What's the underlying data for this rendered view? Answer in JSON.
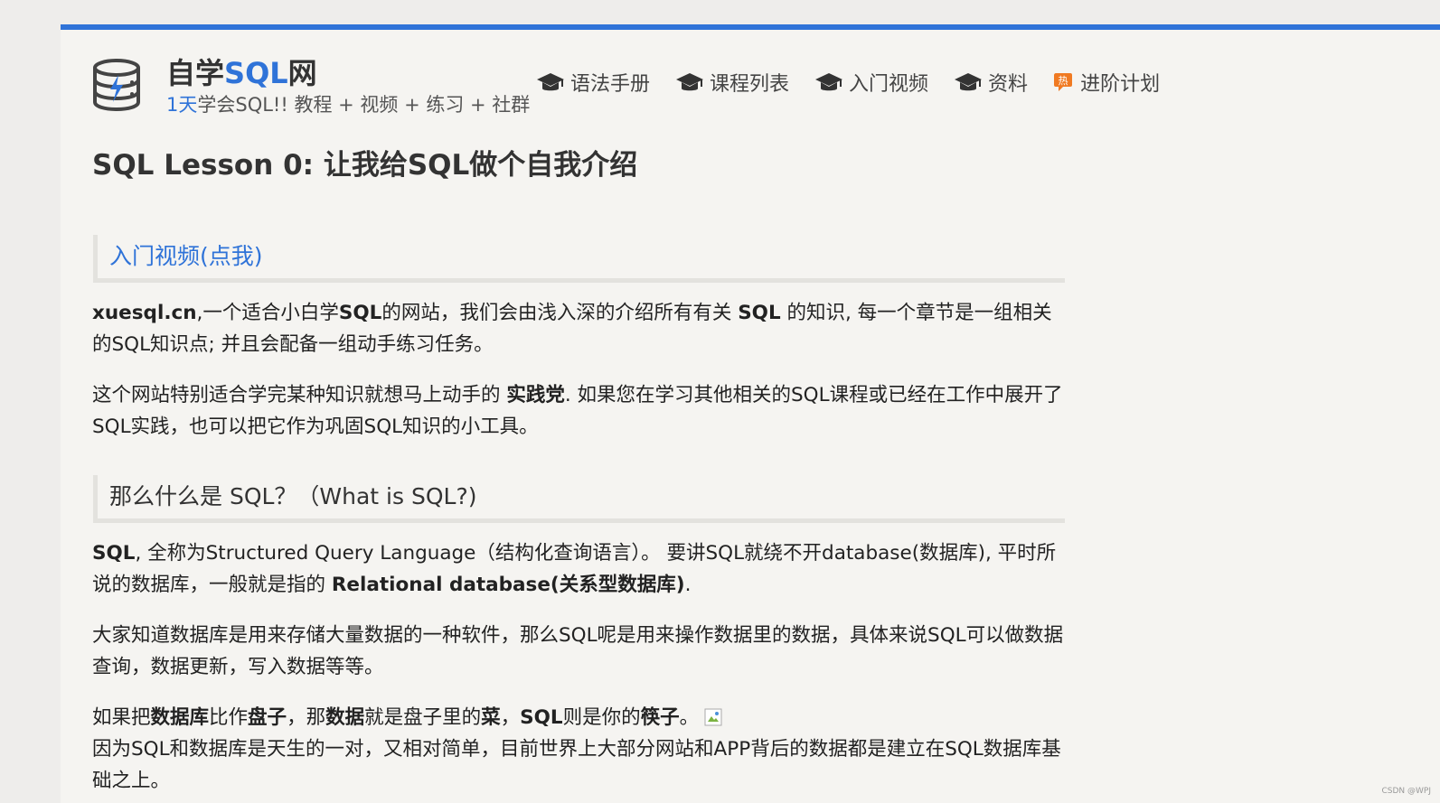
{
  "site": {
    "title_prefix": "自学",
    "title_sql": "SQL",
    "title_suffix": "网",
    "subtitle_num": "1天",
    "subtitle_rest": "学会SQL!! 教程 + 视频 + 练习 + 社群"
  },
  "nav": {
    "items": [
      {
        "label": "语法手册",
        "icon": "graduation-cap-icon"
      },
      {
        "label": "课程列表",
        "icon": "graduation-cap-icon"
      },
      {
        "label": "入门视频",
        "icon": "graduation-cap-icon"
      },
      {
        "label": "资料",
        "icon": "graduation-cap-icon"
      },
      {
        "label": "进阶计划",
        "icon": "hot-badge-icon",
        "badge": "热"
      }
    ]
  },
  "article": {
    "title": "SQL Lesson 0: 让我给SQL做个自我介绍",
    "video_link": "入门视频(点我)",
    "p1": {
      "b1": "xuesql.cn",
      "t1": ",一个适合小白学",
      "b2": "SQL",
      "t2": "的网站，我们会由浅入深的介绍所有有关 ",
      "b3": "SQL",
      "t3": " 的知识, 每一个章节是一组相关的SQL知识点; 并且会配备一组动手练习任务。"
    },
    "p2": {
      "t1": "这个网站特别适合学完某种知识就想马上动手的 ",
      "b1": "实践党",
      "t2": ". 如果您在学习其他相关的SQL课程或已经在工作中展开了SQL实践，也可以把它作为巩固SQL知识的小工具。"
    },
    "what_heading": "那么什么是 SQL？（What is SQL?)",
    "p3": {
      "b1": "SQL",
      "t1": ", 全称为Structured Query Language（结构化查询语言）。 要讲SQL就绕不开database(数据库), 平时所说的数据库，一般就是指的 ",
      "b2": "Relational database(关系型数据库)",
      "t2": "."
    },
    "p4": "大家知道数据库是用来存储大量数据的一种软件，那么SQL呢是用来操作数据里的数据，具体来说SQL可以做数据查询，数据更新，写入数据等等。",
    "p5": {
      "t1": "如果把",
      "b1": "数据库",
      "t2": "比作",
      "b2": "盘子",
      "t3": "，那",
      "b3": "数据",
      "t4": "就是盘子里的",
      "b4": "菜",
      "t5": "，",
      "b5": "SQL",
      "t6": "则是你的",
      "b6": "筷子",
      "t7": "。",
      "line2": "因为SQL和数据库是天生的一对，又相对简单，目前世界上大部分网站和APP背后的数据都是建立在SQL数据库基础之上。"
    }
  },
  "watermark": "CSDN @WPJ",
  "colors": {
    "accent": "#2f73d8",
    "hot": "#f07a22",
    "page_bg": "#f5f4f1"
  }
}
